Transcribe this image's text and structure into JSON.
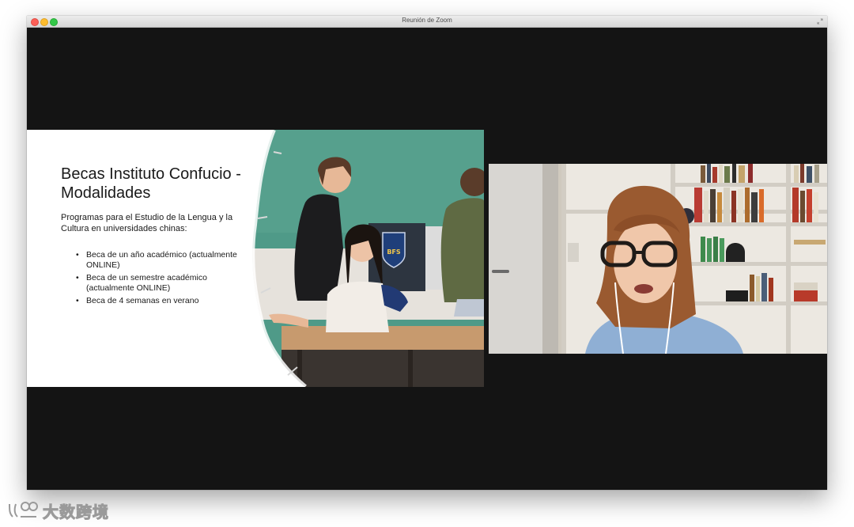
{
  "window": {
    "title": "Reunión de Zoom"
  },
  "slide": {
    "title": "Becas Instituto Confucio - Modalidades",
    "intro": "Programas para el Estudio de la Lengua y la Cultura en universidades chinas:",
    "bullets": [
      "Beca de un año académico (actualmente ONLINE)",
      "Beca de un semestre académico (actualmente ONLINE)",
      "Beca de 4 semanas en verano"
    ],
    "photo_logo_text": "BFS"
  },
  "watermark": {
    "text": "大数跨境"
  },
  "colors": {
    "window_background": "#141414",
    "chalkboard": "#4f9a88",
    "titlebar": "#e0e0e0"
  }
}
